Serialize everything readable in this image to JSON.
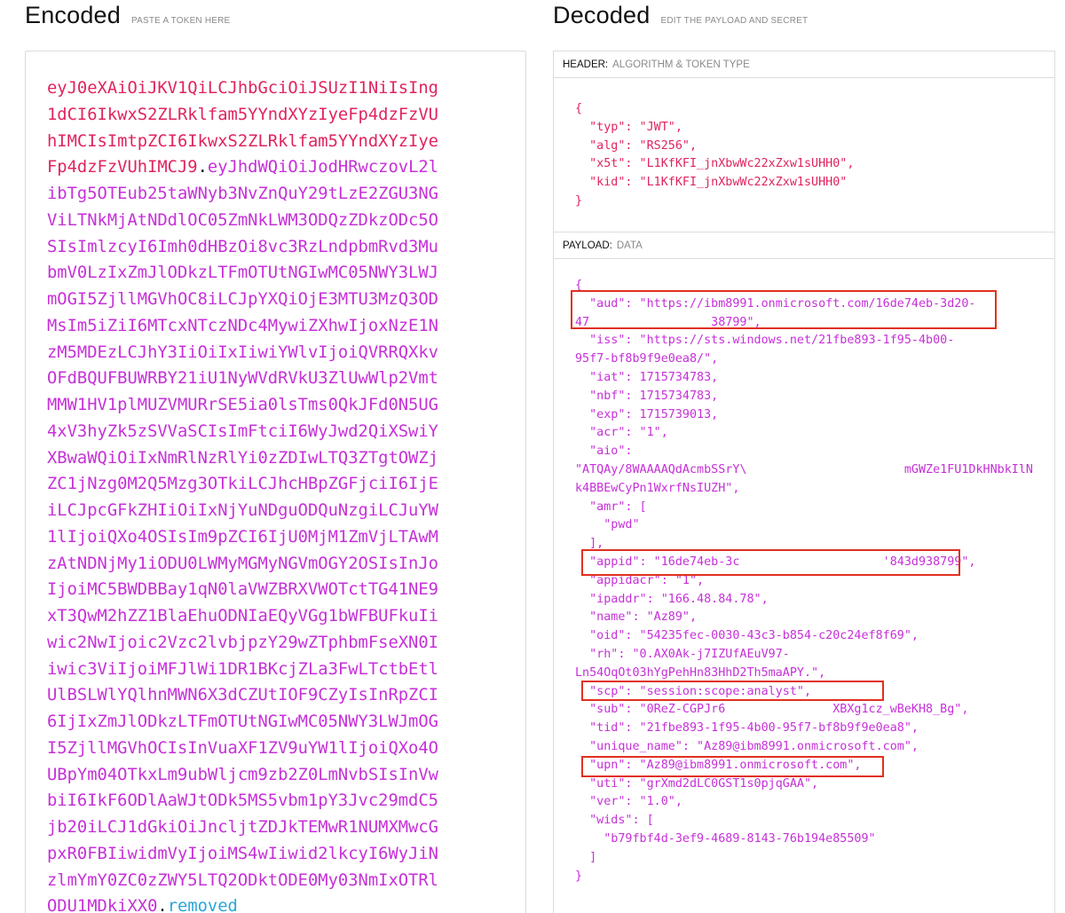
{
  "encoded_section": {
    "title": "Encoded",
    "subtitle": "PASTE A TOKEN HERE",
    "header_part": "eyJ0eXAiOiJKV1QiLCJhbGciOiJSUzI1NiIsIng1dCI6IkwxS2ZLRklfam5YYndXYzIyeFp4dzFzVUhIMCIsImtpZCI6IkwxS2ZLRklfam5YYndXYzIyeFp4dzFzVUhIMCJ9",
    "payload_part": "eyJhdWQiOiJodHRwczovL2libTg5OTEub25taWNyb3NvZnQuY29tLzE2ZGU3NGViLTNkMjAtNDdlOC05ZmNkLWM3ODQzZDkzODc5OSIsImlzcyI6Imh0dHBzOi8vc3RzLndpbmRvd3MubmV0LzIxZmJlODkzLTFmOTUtNGIwMC05NWY3LWJmOGI5ZjllMGVhOC8iLCJpYXQiOjE3MTU3MzQ3ODMsIm5iZiI6MTcxNTczNDc4MywiZXhwIjoxNzE1NzM5MDEzLCJhY3IiOiIxIiwiYWlvIjoiQVRRQXkvOFdBQUFBUWRBY21iU1NyWVdRVkU3ZlUwWlp2VmtMMW1HV1plMUZVMURrSE5ia0lsTms0QkJFd0N5UG4xV3hyZk5zSVVaSCIsImFtciI6WyJwd2QiXSwiYXBwaWQiOiIxNmRlNzRlYi0zZDIwLTQ3ZTgtOWZjZC1jNzg0M2Q5Mzg3OTkiLCJhcHBpZGFjciI6IjEiLCJpcGFkZHIiOiIxNjYuNDguODQuNzgiLCJuYW1lIjoiQXo4OSIsIm9pZCI6IjU0MjM1ZmVjLTAwMzAtNDNjMy1iODU0LWMyMGMyNGVmOGY2OSIsInJoIjoiMC5BWDBBay1qN0laVWZBRXVWOTctTG41NE9xT3QwM2hZZ1BlaEhuODNIaEQyVGg1bWFBUFkuIiwic2NwIjoic2Vzc2lvbjpzY29wZTphbmFseXN0Iiwic3ViIjoiMFJlWi1DR1BKcjZLa3FwLTctbEtlUlBSLWlYQlhnMWN6X3dCZUtIOF9CZyIsInRpZCI6IjIxZmJlODkzLTFmOTUtNGIwMC05NWY3LWJmOGI5ZjllMGVhOCIsInVuaXF1ZV9uYW1lIjoiQXo4OUBpYm04OTkxLm9ubWljcm9zb2Z0LmNvbSIsInVwbiI6IkF6ODlAaWJtODk5MS5vbm1pY3Jvc29mdC5jb20iLCJ1dGkiOiJncljtZDJkTEMwR1NUMXMwcGpxR0FBIiwidmVyIjoiMS4wIiwid2lkcyI6WyJiNzlmYmY0ZC0zZWY5LTQ2ODktODE0My03NmIxOTRlODU1MDkiXX0",
    "signature_part": "removed"
  },
  "decoded_section": {
    "title": "Decoded",
    "subtitle": "EDIT THE PAYLOAD AND SECRET",
    "header_panel": {
      "label": "HEADER:",
      "sublabel": "ALGORITHM & TOKEN TYPE",
      "json_text": "{\n  \"typ\": \"JWT\",\n  \"alg\": \"RS256\",\n  \"x5t\": \"L1KfKFI_jnXbwWc22xZxw1sUHH0\",\n  \"kid\": \"L1KfKFI_jnXbwWc22xZxw1sUHH0\"\n}"
    },
    "payload_panel": {
      "label": "PAYLOAD:",
      "sublabel": "DATA",
      "json_text": "{\n  \"aud\": \"https://ibm8991.onmicrosoft.com/16de74eb-3d20-\n47                 38799\",\n  \"iss\": \"https://sts.windows.net/21fbe893-1f95-4b00-\n95f7-bf8b9f9e0ea8/\",\n  \"iat\": 1715734783,\n  \"nbf\": 1715734783,\n  \"exp\": 1715739013,\n  \"acr\": \"1\",\n  \"aio\":\n\"ATQAy/8WAAAAQdAcmbSSrY\\                      mGWZe1FU1DkHNbkIlN\nk4BBEwCyPn1WxrfNsIUZH\",\n  \"amr\": [\n    \"pwd\"\n  ],\n  \"appid\": \"16de74eb-3c                    '843d938799\",\n  \"appidacr\": \"1\",\n  \"ipaddr\": \"166.48.84.78\",\n  \"name\": \"Az89\",\n  \"oid\": \"54235fec-0030-43c3-b854-c20c24ef8f69\",\n  \"rh\": \"0.AX0Ak-j7IZUfAEuV97-\nLn54OqOt03hYgPehHn83HhD2Th5maAPY.\",\n  \"scp\": \"session:scope:analyst\",\n  \"sub\": \"0ReZ-CGPJr6               XBXg1cz_wBeKH8_Bg\",\n  \"tid\": \"21fbe893-1f95-4b00-95f7-bf8b9f9e0ea8\",\n  \"unique_name\": \"Az89@ibm8991.onmicrosoft.com\",\n  \"upn\": \"Az89@ibm8991.onmicrosoft.com\",\n  \"uti\": \"grXmd2dLC0GST1s0pjqGAA\",\n  \"ver\": \"1.0\",\n  \"wids\": [\n    \"b79fbf4d-3ef9-4689-8143-76b194e85509\"\n  ]\n}"
    }
  },
  "colors": {
    "header_text": "#e0245e",
    "payload_text": "#c630d8",
    "signature_text": "#2aa7d8",
    "highlight_box": "#e0301e"
  }
}
